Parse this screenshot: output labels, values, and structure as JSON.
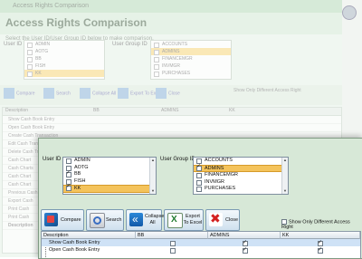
{
  "background": {
    "title_bar": "Access Rights Comparison",
    "heading": "Access Rights Comparison",
    "subtitle": "Select the User ID/User Group ID below to make comparison.",
    "user_id_label": "User ID",
    "group_id_label": "User Group ID",
    "users": [
      "ADMIN",
      "AOTG",
      "BB",
      "FISH",
      "KK"
    ],
    "groups": [
      "ACCOUNTS",
      "ADMINS",
      "FINANCEMGR",
      "INVMGR",
      "PURCHASES"
    ],
    "buttons": [
      "Compare",
      "Search",
      "Collapse All",
      "Export To Excel",
      "Close"
    ],
    "show_only": "Show Only Different Access Right",
    "columns": [
      "Description",
      "BB",
      "ADMINS",
      "KK"
    ],
    "rows": [
      "Show Cash Book Entry",
      "Open Cash Book Entry",
      "Create Cash Transaction",
      "Edit Cash Transaction",
      "Delete Cash Transaction",
      "Cash Chart",
      "Cash Charts",
      "Cash Chart",
      "Cash Chart",
      "Previous Cash",
      "Export Cash",
      "Print Cash",
      "Print Cash"
    ],
    "footer": "Description"
  },
  "panel": {
    "user_id_label": "User ID",
    "group_id_label": "User Group ID",
    "users": [
      {
        "label": "ADMIN",
        "checked": false,
        "selected": false
      },
      {
        "label": "AOTG",
        "checked": false,
        "selected": false
      },
      {
        "label": "BB",
        "checked": true,
        "selected": false
      },
      {
        "label": "FISH",
        "checked": false,
        "selected": false
      },
      {
        "label": "KK",
        "checked": true,
        "selected": true
      }
    ],
    "groups": [
      {
        "label": "ACCOUNTS",
        "checked": false,
        "selected": false
      },
      {
        "label": "ADMINS",
        "checked": true,
        "selected": true
      },
      {
        "label": "FINANCEMGR",
        "checked": false,
        "selected": false
      },
      {
        "label": "INVMGR",
        "checked": false,
        "selected": false
      },
      {
        "label": "PURCHASES",
        "checked": false,
        "selected": false
      }
    ],
    "toolbar": {
      "compare": "Compare",
      "search": "Search",
      "collapse_1": "Collapse",
      "collapse_2": "All",
      "export_1": "Export",
      "export_2": "To Excel",
      "close": "Close"
    },
    "show_only_label": "Show Only Different Access Right",
    "grid": {
      "columns": [
        "Description",
        "BB",
        "ADMINS",
        "KK"
      ],
      "rows": [
        {
          "description": "Show Cash Book Entry",
          "bb": false,
          "admins": true,
          "kk": true,
          "selected": true
        },
        {
          "description": "Open Cash Book Entry",
          "bb": false,
          "admins": true,
          "kk": true,
          "selected": false
        }
      ]
    }
  },
  "colors": {
    "panel_bg": "#d7e8d7",
    "selection": "#f4c35b",
    "row_selection": "#cfe2f6"
  }
}
